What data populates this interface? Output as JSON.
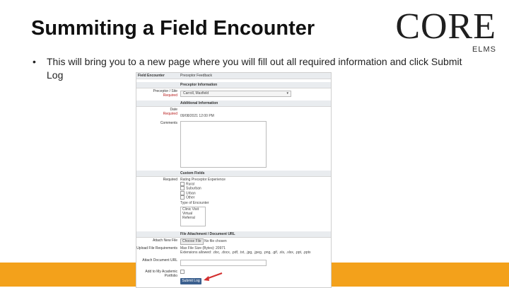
{
  "slide": {
    "title": "Summiting a Field Encounter",
    "logo_main": "CORE",
    "logo_sub": "ELMS",
    "bullet_symbol": "•",
    "bullet_text": "This will bring you to a new page where you will fill out all required information and click Submit Log",
    "accent_color": "#f3a11b"
  },
  "form": {
    "heading_label": "Field Encounter",
    "heading_value": "Preceptor Feedback",
    "preceptor_section": "Preceptor Information",
    "preceptor_label": "Preceptor / Site",
    "required": "Required",
    "preceptor_value": "Carroll, Maxfield",
    "additional_section": "Additional Information",
    "date_label": "Date",
    "date_value": "09/08/2021 12:00 PM",
    "comments_label": "Comments",
    "custom_section": "Custom Fields",
    "visits_label": "Rating Preceptor Experience",
    "visit_options": [
      "Rural",
      "Suburban",
      "Urban",
      "Other"
    ],
    "type_label": "Type of Encounter",
    "type_options": [
      "Clinic Visit",
      "Virtual",
      "Referral"
    ],
    "attach_section": "File Attachment / Document URL",
    "attach_label": "Attach New File",
    "choose_file": "Choose File",
    "no_file": "No file chosen",
    "upload_label": "Upload File Requirements",
    "upload_text": "Max File Size (Bytes): 20971",
    "ext_text": "Extensions allowed: .doc, .docx, .pdf, .txt, .jpg, .jpeg, .png, .gif, .xls, .xlsx, .ppt, .pptx",
    "url_label": "Attach Document URL",
    "add_label": "Add to My Academic Portfolio",
    "submit_label": "Submit Log"
  }
}
